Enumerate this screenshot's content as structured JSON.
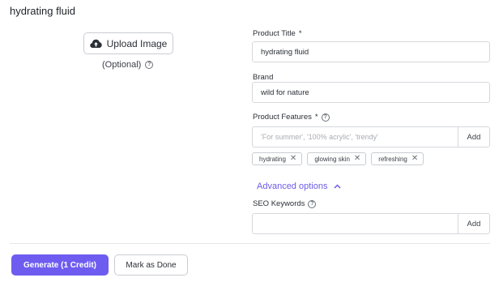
{
  "header": {
    "title": "hydrating fluid"
  },
  "upload": {
    "button_label": "Upload Image",
    "optional_label": "(Optional)"
  },
  "form": {
    "product_title": {
      "label": "Product Title",
      "required_mark": "*",
      "value": "hydrating fluid"
    },
    "brand": {
      "label": "Brand",
      "value": "wild for nature"
    },
    "product_features": {
      "label": "Product Features",
      "required_mark": "*",
      "placeholder": "'For summer', '100% acrylic', 'trendy'",
      "add_label": "Add",
      "tags": [
        "hydrating",
        "glowing skin",
        "refreshing"
      ],
      "remove_glyph": "✕"
    },
    "advanced_options": {
      "label": "Advanced options",
      "expanded": true
    },
    "seo_keywords": {
      "label": "SEO Keywords",
      "value": "",
      "add_label": "Add"
    }
  },
  "footer": {
    "generate_label": "Generate (1 Credit)",
    "mark_done_label": "Mark as Done"
  },
  "colors": {
    "accent": "#6e5cf0",
    "link": "#6b5ce7",
    "border": "#d5d8dd"
  },
  "icons": {
    "upload": "cloud-upload-icon",
    "help": "question-circle-icon",
    "chevron": "chevron-up-icon",
    "remove": "close-icon"
  }
}
